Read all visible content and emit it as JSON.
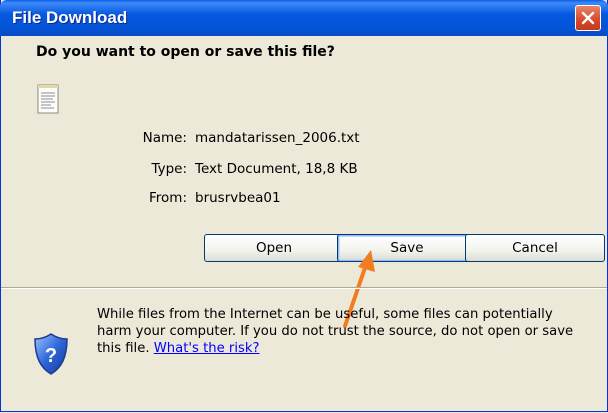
{
  "window": {
    "title": "File Download"
  },
  "prompt": {
    "question": "Do you want to open or save this file?"
  },
  "file": {
    "icon": "text-file-icon",
    "name_label": "Name:",
    "name": "mandatarissen_2006.txt",
    "type_label": "Type:",
    "type": "Text Document, 18,8 KB",
    "from_label": "From:",
    "from": "brusrvbea01"
  },
  "buttons": {
    "open": "Open",
    "save": "Save",
    "cancel": "Cancel"
  },
  "warning": {
    "icon": "security-shield-icon",
    "text": "While files from the Internet can be useful, some files can potentially harm your computer. If you do not trust the source, do not open or save this file.",
    "link": "What's the risk?"
  },
  "colors": {
    "titlebar": "#0454d6",
    "annotation_arrow": "#f47c20",
    "link": "#0000ff"
  }
}
